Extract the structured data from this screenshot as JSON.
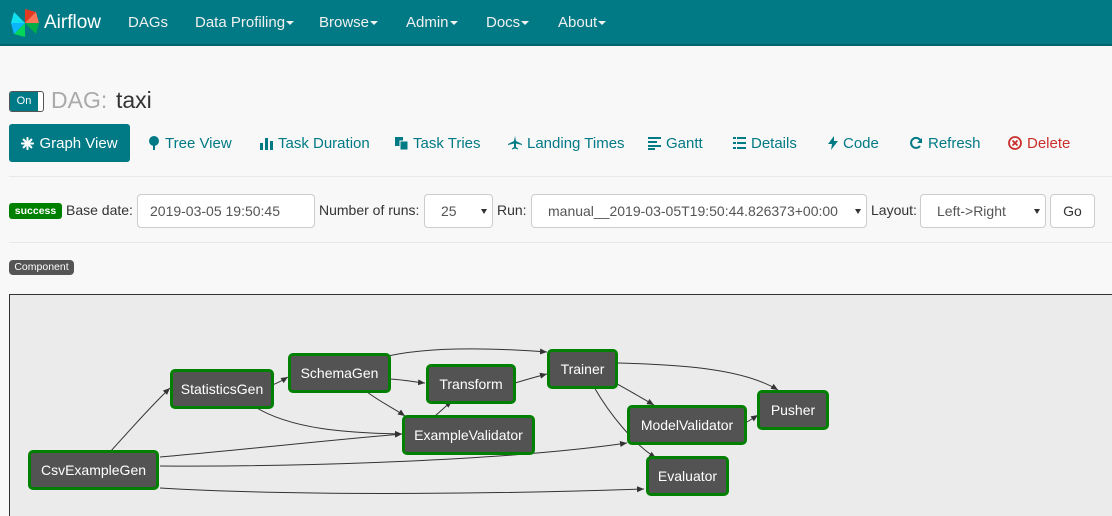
{
  "navbar": {
    "brand": "Airflow",
    "items": [
      "DAGs",
      "Data Profiling",
      "Browse",
      "Admin",
      "Docs",
      "About"
    ]
  },
  "dag": {
    "toggle_label": "On",
    "label": "DAG:",
    "id": "taxi"
  },
  "tabs": [
    {
      "label": "Graph View",
      "icon": "asterisk-icon"
    },
    {
      "label": "Tree View",
      "icon": "tree-icon"
    },
    {
      "label": "Task Duration",
      "icon": "bar-chart-icon"
    },
    {
      "label": "Task Tries",
      "icon": "duplicate-icon"
    },
    {
      "label": "Landing Times",
      "icon": "plane-icon"
    },
    {
      "label": "Gantt",
      "icon": "gantt-icon"
    },
    {
      "label": "Details",
      "icon": "list-icon"
    },
    {
      "label": "Code",
      "icon": "flash-icon"
    },
    {
      "label": "Refresh",
      "icon": "refresh-icon"
    },
    {
      "label": "Delete",
      "icon": "remove-circle-icon"
    }
  ],
  "form": {
    "state_badge": "success",
    "base_date_label": "Base date:",
    "base_date_value": "2019-03-05 19:50:45",
    "num_runs_label": "Number of runs:",
    "num_runs_value": "25",
    "run_label": "Run:",
    "run_value": "manual__2019-03-05T19:50:44.826373+00:00",
    "layout_label": "Layout:",
    "layout_value": "Left->Right",
    "go_label": "Go"
  },
  "legend": {
    "operator_label": "Component"
  },
  "graph": {
    "nodes": [
      "CsvExampleGen",
      "StatisticsGen",
      "SchemaGen",
      "Transform",
      "ExampleValidator",
      "Trainer",
      "ModelValidator",
      "Evaluator",
      "Pusher"
    ],
    "task_state_color": "#008000",
    "task_fill_color": "#535353"
  }
}
